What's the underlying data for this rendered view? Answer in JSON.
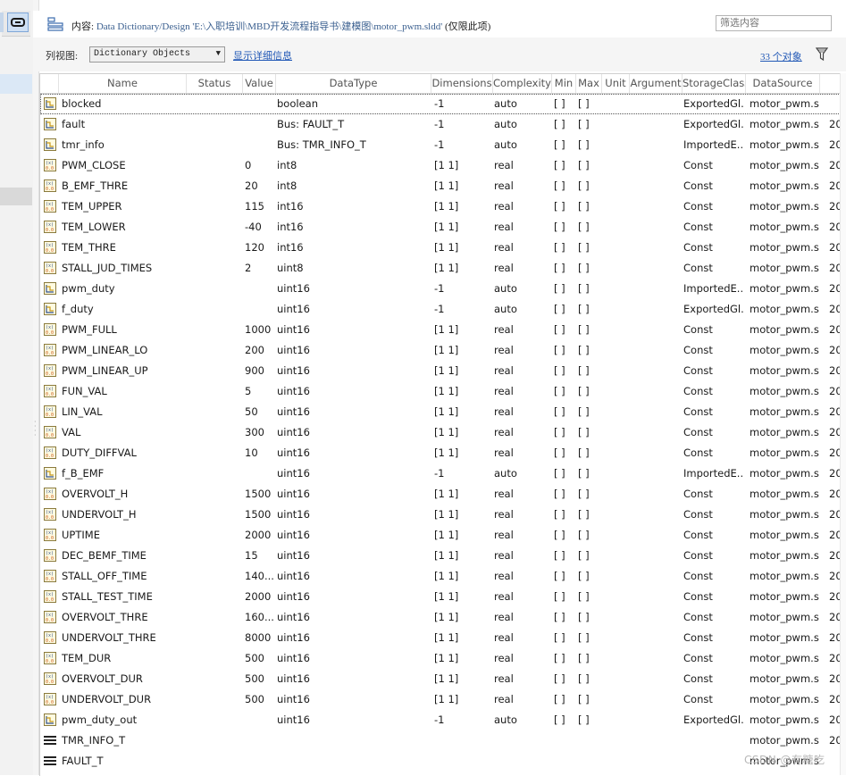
{
  "path": {
    "label": "内容:",
    "value": "Data Dictionary/Design 'E:\\入职培训\\MBD开发流程指导书\\建模图\\motor_pwm.sldd'",
    "suffix": "(仅限此项)"
  },
  "filter": {
    "placeholder": "筛选内容"
  },
  "view": {
    "label": "列视图:",
    "selected": "Dictionary Objects",
    "details_link": "显示详细信息",
    "count_link": "33 个对象"
  },
  "columns": [
    "Name",
    "Status",
    "Value",
    "DataType",
    "Dimensions",
    "Complexity",
    "Min",
    "Max",
    "Unit",
    "Argument",
    "StorageClass",
    "DataSource"
  ],
  "icons": {
    "signal": "signal-object-icon",
    "parameter": "parameter-object-icon",
    "bus": "bus-type-icon",
    "funnel": "filter-funnel-icon",
    "dictionary": "dictionary-tree-icon"
  },
  "rows": [
    {
      "kind": "signal",
      "name": "blocked",
      "status": "",
      "value": "",
      "dtype": "boolean",
      "dims": "-1",
      "cplx": "auto",
      "min": "[ ]",
      "max": "[ ]",
      "sc": "ExportedGl...",
      "ds": "motor_pwm.s...",
      "extra": ""
    },
    {
      "kind": "signal",
      "name": "fault",
      "status": "",
      "value": "",
      "dtype": "Bus: FAULT_T",
      "dims": "-1",
      "cplx": "auto",
      "min": "[ ]",
      "max": "[ ]",
      "sc": "ExportedGl...",
      "ds": "motor_pwm.s...",
      "extra": "20"
    },
    {
      "kind": "signal",
      "name": "tmr_info",
      "status": "",
      "value": "",
      "dtype": "Bus: TMR_INFO_T",
      "dims": "-1",
      "cplx": "auto",
      "min": "[ ]",
      "max": "[ ]",
      "sc": "ImportedE...",
      "ds": "motor_pwm.s...",
      "extra": "20"
    },
    {
      "kind": "parameter",
      "name": "PWM_CLOSE",
      "status": "",
      "value": "0",
      "dtype": "int8",
      "dims": "[1 1]",
      "cplx": "real",
      "min": "[ ]",
      "max": "[ ]",
      "sc": "Const",
      "ds": "motor_pwm.s...",
      "extra": "20"
    },
    {
      "kind": "parameter",
      "name": "B_EMF_THRE",
      "status": "",
      "value": "20",
      "dtype": "int8",
      "dims": "[1 1]",
      "cplx": "real",
      "min": "[ ]",
      "max": "[ ]",
      "sc": "Const",
      "ds": "motor_pwm.s...",
      "extra": "20"
    },
    {
      "kind": "parameter",
      "name": "TEM_UPPER",
      "status": "",
      "value": "115",
      "dtype": "int16",
      "dims": "[1 1]",
      "cplx": "real",
      "min": "[ ]",
      "max": "[ ]",
      "sc": "Const",
      "ds": "motor_pwm.s...",
      "extra": "20"
    },
    {
      "kind": "parameter",
      "name": "TEM_LOWER",
      "status": "",
      "value": "-40",
      "dtype": "int16",
      "dims": "[1 1]",
      "cplx": "real",
      "min": "[ ]",
      "max": "[ ]",
      "sc": "Const",
      "ds": "motor_pwm.s...",
      "extra": "20"
    },
    {
      "kind": "parameter",
      "name": "TEM_THRE",
      "status": "",
      "value": "120",
      "dtype": "int16",
      "dims": "[1 1]",
      "cplx": "real",
      "min": "[ ]",
      "max": "[ ]",
      "sc": "Const",
      "ds": "motor_pwm.s...",
      "extra": "20"
    },
    {
      "kind": "parameter",
      "name": "STALL_JUD_TIMES",
      "status": "",
      "value": "2",
      "dtype": "uint8",
      "dims": "[1 1]",
      "cplx": "real",
      "min": "[ ]",
      "max": "[ ]",
      "sc": "Const",
      "ds": "motor_pwm.s...",
      "extra": "20"
    },
    {
      "kind": "signal",
      "name": "pwm_duty",
      "status": "",
      "value": "",
      "dtype": "uint16",
      "dims": "-1",
      "cplx": "auto",
      "min": "[ ]",
      "max": "[ ]",
      "sc": "ImportedE...",
      "ds": "motor_pwm.s...",
      "extra": "20"
    },
    {
      "kind": "signal",
      "name": "f_duty",
      "status": "",
      "value": "",
      "dtype": "uint16",
      "dims": "-1",
      "cplx": "auto",
      "min": "[ ]",
      "max": "[ ]",
      "sc": "ExportedGl...",
      "ds": "motor_pwm.s...",
      "extra": "20"
    },
    {
      "kind": "parameter",
      "name": "PWM_FULL",
      "status": "",
      "value": "1000",
      "dtype": "uint16",
      "dims": "[1 1]",
      "cplx": "real",
      "min": "[ ]",
      "max": "[ ]",
      "sc": "Const",
      "ds": "motor_pwm.s...",
      "extra": "20"
    },
    {
      "kind": "parameter",
      "name": "PWM_LINEAR_LO",
      "status": "",
      "value": "200",
      "dtype": "uint16",
      "dims": "[1 1]",
      "cplx": "real",
      "min": "[ ]",
      "max": "[ ]",
      "sc": "Const",
      "ds": "motor_pwm.s...",
      "extra": "20"
    },
    {
      "kind": "parameter",
      "name": "PWM_LINEAR_UP",
      "status": "",
      "value": "900",
      "dtype": "uint16",
      "dims": "[1 1]",
      "cplx": "real",
      "min": "[ ]",
      "max": "[ ]",
      "sc": "Const",
      "ds": "motor_pwm.s...",
      "extra": "20"
    },
    {
      "kind": "parameter",
      "name": "FUN_VAL",
      "status": "",
      "value": "5",
      "dtype": "uint16",
      "dims": "[1 1]",
      "cplx": "real",
      "min": "[ ]",
      "max": "[ ]",
      "sc": "Const",
      "ds": "motor_pwm.s...",
      "extra": "20"
    },
    {
      "kind": "parameter",
      "name": "LIN_VAL",
      "status": "",
      "value": "50",
      "dtype": "uint16",
      "dims": "[1 1]",
      "cplx": "real",
      "min": "[ ]",
      "max": "[ ]",
      "sc": "Const",
      "ds": "motor_pwm.s...",
      "extra": "20"
    },
    {
      "kind": "parameter",
      "name": "VAL",
      "status": "",
      "value": "300",
      "dtype": "uint16",
      "dims": "[1 1]",
      "cplx": "real",
      "min": "[ ]",
      "max": "[ ]",
      "sc": "Const",
      "ds": "motor_pwm.s...",
      "extra": "20"
    },
    {
      "kind": "parameter",
      "name": "DUTY_DIFFVAL",
      "status": "",
      "value": "10",
      "dtype": "uint16",
      "dims": "[1 1]",
      "cplx": "real",
      "min": "[ ]",
      "max": "[ ]",
      "sc": "Const",
      "ds": "motor_pwm.s...",
      "extra": "20"
    },
    {
      "kind": "signal",
      "name": "f_B_EMF",
      "status": "",
      "value": "",
      "dtype": "uint16",
      "dims": "-1",
      "cplx": "auto",
      "min": "[ ]",
      "max": "[ ]",
      "sc": "ImportedE...",
      "ds": "motor_pwm.s...",
      "extra": "20"
    },
    {
      "kind": "parameter",
      "name": "OVERVOLT_H",
      "status": "",
      "value": "1500",
      "dtype": "uint16",
      "dims": "[1 1]",
      "cplx": "real",
      "min": "[ ]",
      "max": "[ ]",
      "sc": "Const",
      "ds": "motor_pwm.s...",
      "extra": "20"
    },
    {
      "kind": "parameter",
      "name": "UNDERVOLT_H",
      "status": "",
      "value": "1500",
      "dtype": "uint16",
      "dims": "[1 1]",
      "cplx": "real",
      "min": "[ ]",
      "max": "[ ]",
      "sc": "Const",
      "ds": "motor_pwm.s...",
      "extra": "20"
    },
    {
      "kind": "parameter",
      "name": "UPTIME",
      "status": "",
      "value": "2000",
      "dtype": "uint16",
      "dims": "[1 1]",
      "cplx": "real",
      "min": "[ ]",
      "max": "[ ]",
      "sc": "Const",
      "ds": "motor_pwm.s...",
      "extra": "20"
    },
    {
      "kind": "parameter",
      "name": "DEC_BEMF_TIME",
      "status": "",
      "value": "15",
      "dtype": "uint16",
      "dims": "[1 1]",
      "cplx": "real",
      "min": "[ ]",
      "max": "[ ]",
      "sc": "Const",
      "ds": "motor_pwm.s...",
      "extra": "20"
    },
    {
      "kind": "parameter",
      "name": "STALL_OFF_TIME",
      "status": "",
      "value": "140...",
      "dtype": "uint16",
      "dims": "[1 1]",
      "cplx": "real",
      "min": "[ ]",
      "max": "[ ]",
      "sc": "Const",
      "ds": "motor_pwm.s...",
      "extra": "20"
    },
    {
      "kind": "parameter",
      "name": "STALL_TEST_TIME",
      "status": "",
      "value": "2000",
      "dtype": "uint16",
      "dims": "[1 1]",
      "cplx": "real",
      "min": "[ ]",
      "max": "[ ]",
      "sc": "Const",
      "ds": "motor_pwm.s...",
      "extra": "20"
    },
    {
      "kind": "parameter",
      "name": "OVERVOLT_THRE",
      "status": "",
      "value": "160...",
      "dtype": "uint16",
      "dims": "[1 1]",
      "cplx": "real",
      "min": "[ ]",
      "max": "[ ]",
      "sc": "Const",
      "ds": "motor_pwm.s...",
      "extra": "20"
    },
    {
      "kind": "parameter",
      "name": "UNDERVOLT_THRE",
      "status": "",
      "value": "8000",
      "dtype": "uint16",
      "dims": "[1 1]",
      "cplx": "real",
      "min": "[ ]",
      "max": "[ ]",
      "sc": "Const",
      "ds": "motor_pwm.s...",
      "extra": "20"
    },
    {
      "kind": "parameter",
      "name": "TEM_DUR",
      "status": "",
      "value": "500",
      "dtype": "uint16",
      "dims": "[1 1]",
      "cplx": "real",
      "min": "[ ]",
      "max": "[ ]",
      "sc": "Const",
      "ds": "motor_pwm.s...",
      "extra": "20"
    },
    {
      "kind": "parameter",
      "name": "OVERVOLT_DUR",
      "status": "",
      "value": "500",
      "dtype": "uint16",
      "dims": "[1 1]",
      "cplx": "real",
      "min": "[ ]",
      "max": "[ ]",
      "sc": "Const",
      "ds": "motor_pwm.s...",
      "extra": "20"
    },
    {
      "kind": "parameter",
      "name": "UNDERVOLT_DUR",
      "status": "",
      "value": "500",
      "dtype": "uint16",
      "dims": "[1 1]",
      "cplx": "real",
      "min": "[ ]",
      "max": "[ ]",
      "sc": "Const",
      "ds": "motor_pwm.s...",
      "extra": "20"
    },
    {
      "kind": "signal",
      "name": "pwm_duty_out",
      "status": "",
      "value": "",
      "dtype": "uint16",
      "dims": "-1",
      "cplx": "auto",
      "min": "[ ]",
      "max": "[ ]",
      "sc": "ExportedGl...",
      "ds": "motor_pwm.s...",
      "extra": "20"
    },
    {
      "kind": "bus",
      "name": "TMR_INFO_T",
      "status": "",
      "value": "",
      "dtype": "",
      "dims": "",
      "cplx": "",
      "min": "",
      "max": "",
      "sc": "",
      "ds": "motor_pwm.s...",
      "extra": "20"
    },
    {
      "kind": "bus",
      "name": "FAULT_T",
      "status": "",
      "value": "",
      "dtype": "",
      "dims": "",
      "cplx": "",
      "min": "",
      "max": "",
      "sc": "",
      "ds": "motor_pwm.s...",
      "extra": ""
    }
  ],
  "watermark": "CSDN @有糖吃"
}
